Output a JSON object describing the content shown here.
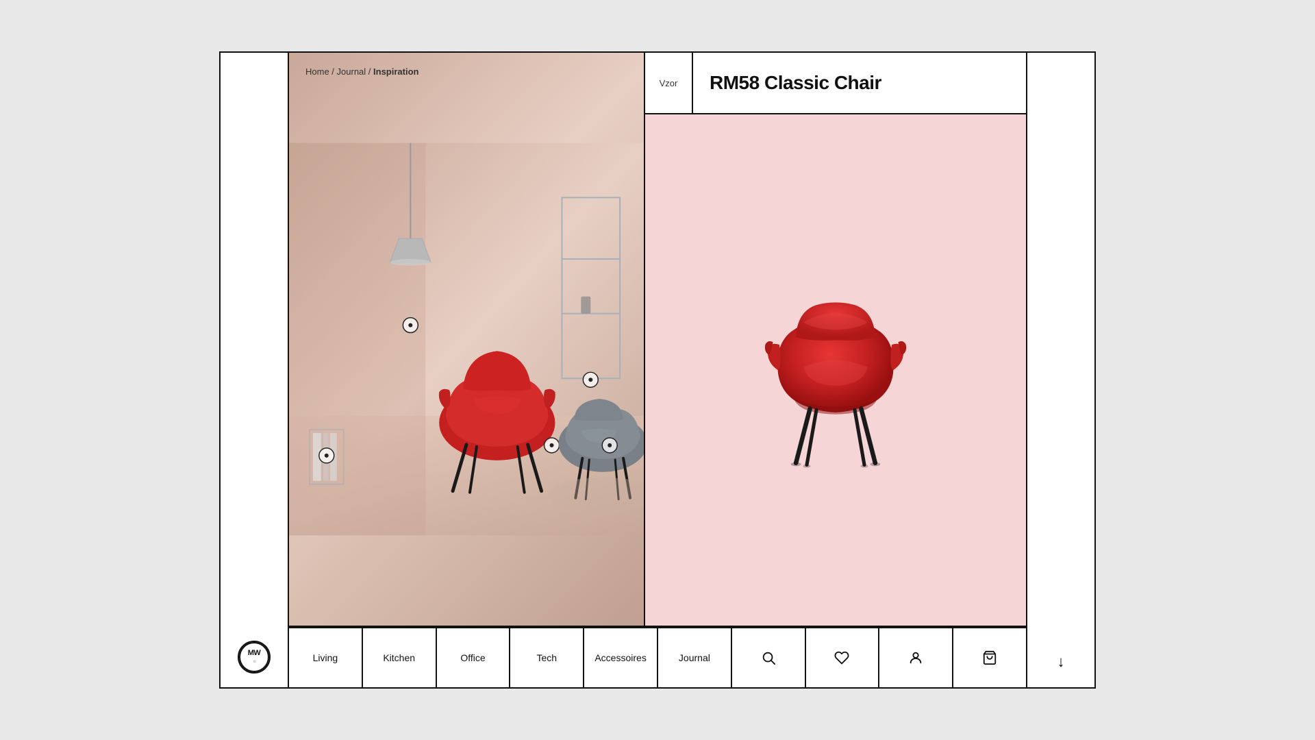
{
  "breadcrumb": {
    "home": "Home",
    "journal": "Journal",
    "separator": " / ",
    "current": "Inspiration"
  },
  "product": {
    "vzor_label": "Vzor",
    "title": "RM58 Classic Chair"
  },
  "navigation": {
    "items": [
      {
        "id": "living",
        "label": "Living"
      },
      {
        "id": "kitchen",
        "label": "Kitchen"
      },
      {
        "id": "office",
        "label": "Office"
      },
      {
        "id": "tech",
        "label": "Tech"
      },
      {
        "id": "accessoires",
        "label": "Accessoires"
      },
      {
        "id": "journal",
        "label": "Journal"
      }
    ],
    "icon_items": [
      {
        "id": "search",
        "icon": "search-icon"
      },
      {
        "id": "wishlist",
        "icon": "heart-icon"
      },
      {
        "id": "account",
        "icon": "user-icon"
      },
      {
        "id": "cart",
        "icon": "bag-icon"
      }
    ]
  },
  "logo": {
    "text": "MW"
  },
  "download_label": "↓",
  "colors": {
    "accent_red": "#d42b2b",
    "product_bg": "#f5d5d5",
    "scene_bg": "#d4b8a8"
  }
}
